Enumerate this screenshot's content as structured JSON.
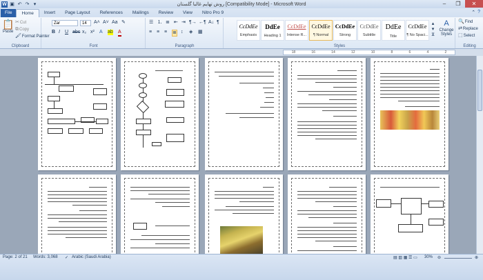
{
  "window": {
    "title": "روش تهایم غالبا گلستان [Compatibility Mode] - Microsoft Word"
  },
  "tabs": [
    "File",
    "Home",
    "Insert",
    "Page Layout",
    "References",
    "Mailings",
    "Review",
    "View",
    "Nitro Pro 9"
  ],
  "ribbon": {
    "clipboard": {
      "paste": "Paste",
      "cut": "Cut",
      "copy": "Copy",
      "format_painter": "Format Painter",
      "label": "Clipboard"
    },
    "font": {
      "font_name": "Zar",
      "font_size": "14",
      "label": "Font"
    },
    "paragraph": {
      "label": "Paragraph"
    },
    "styles": {
      "label": "Styles",
      "items": [
        {
          "preview": "CcDdEe",
          "name": "Emphasis"
        },
        {
          "preview": "DdEe",
          "name": "Heading 1"
        },
        {
          "preview": "CcDdEe",
          "name": "Intense R..."
        },
        {
          "preview": "CcDdEe",
          "name": "¶ Normal"
        },
        {
          "preview": "CcDdEe",
          "name": "Strong"
        },
        {
          "preview": "CcDdEe",
          "name": "Subtitle"
        },
        {
          "preview": "DdEe",
          "name": "Title"
        },
        {
          "preview": "CcDdEe",
          "name": "¶ No Spaci..."
        }
      ],
      "change_styles": "Change Styles"
    },
    "editing": {
      "find": "Find",
      "replace": "Replace",
      "select": "Select",
      "label": "Editing"
    }
  },
  "ruler": {
    "ticks": [
      "18",
      "16",
      "14",
      "12",
      "10",
      "8",
      "6",
      "4",
      "2"
    ]
  },
  "status": {
    "page": "Page: 2 of 21",
    "words": "Words: 3,068",
    "language": "Arabic (Saudi Arabia)",
    "zoom": "30%"
  },
  "doc": {
    "p1_heading": "مقدمه",
    "p2_heading": "شکل ۱",
    "p3_heading": "مقدمه",
    "p4_heading": "گل ها",
    "p5_heading": "گل ها"
  }
}
